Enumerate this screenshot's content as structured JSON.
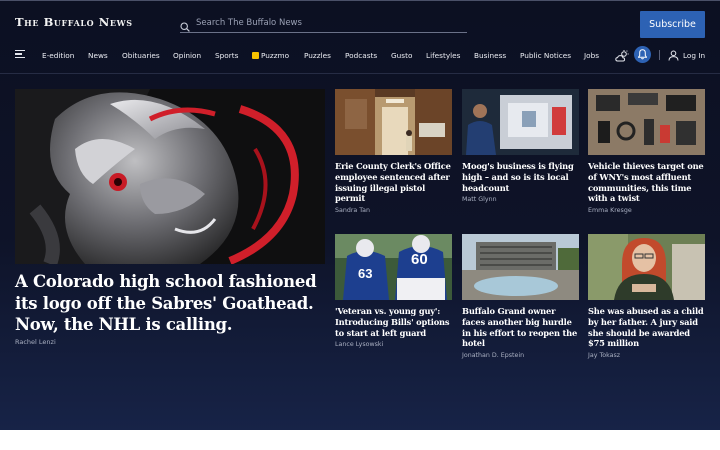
{
  "header": {
    "logo_text": "The Buffalo News",
    "search_placeholder": "Search The Buffalo News",
    "subscribe_label": "Subscribe"
  },
  "nav": {
    "items": [
      "E-edition",
      "News",
      "Obituaries",
      "Opinion",
      "Sports",
      "Puzzmo",
      "Puzzles",
      "Podcasts",
      "Gusto",
      "Lifestyles",
      "Business",
      "Public Notices",
      "Jobs"
    ],
    "login_label": "Log In"
  },
  "hero": {
    "headline": "A Colorado high school fashioned its logo off the Sabres' Goathead. Now, the NHL is calling.",
    "byline": "Rachel Lenzi"
  },
  "stories": [
    {
      "headline": "Erie County Clerk's Office employee sentenced after issuing illegal pistol permit",
      "byline": "Sandra Tan"
    },
    {
      "headline": "Moog's business is flying high – and so is its local headcount",
      "byline": "Matt Glynn"
    },
    {
      "headline": "Vehicle thieves target one of WNY's most affluent communities, this time with a twist",
      "byline": "Emma Kresge"
    },
    {
      "headline": "'Veteran vs. young guy': Introducing Bills' options to start at left guard",
      "byline": "Lance Lysowski"
    },
    {
      "headline": "Buffalo Grand owner faces another big hurdle in his effort to reopen the hotel",
      "byline": "Jonathan D. Epstein"
    },
    {
      "headline": "She was abused as a child by her father. A jury said she should be awarded $75 million",
      "byline": "Jay Tokasz"
    }
  ],
  "colors": {
    "background": "#0c1022",
    "accent": "#2d62b4",
    "puzzmo": "#f6c200",
    "jersey_red": "#d01f2a"
  },
  "icons": {
    "search": "search-icon",
    "menu": "hamburger-icon",
    "weather": "weather-icon",
    "notifications": "bell-icon",
    "account": "user-icon"
  }
}
